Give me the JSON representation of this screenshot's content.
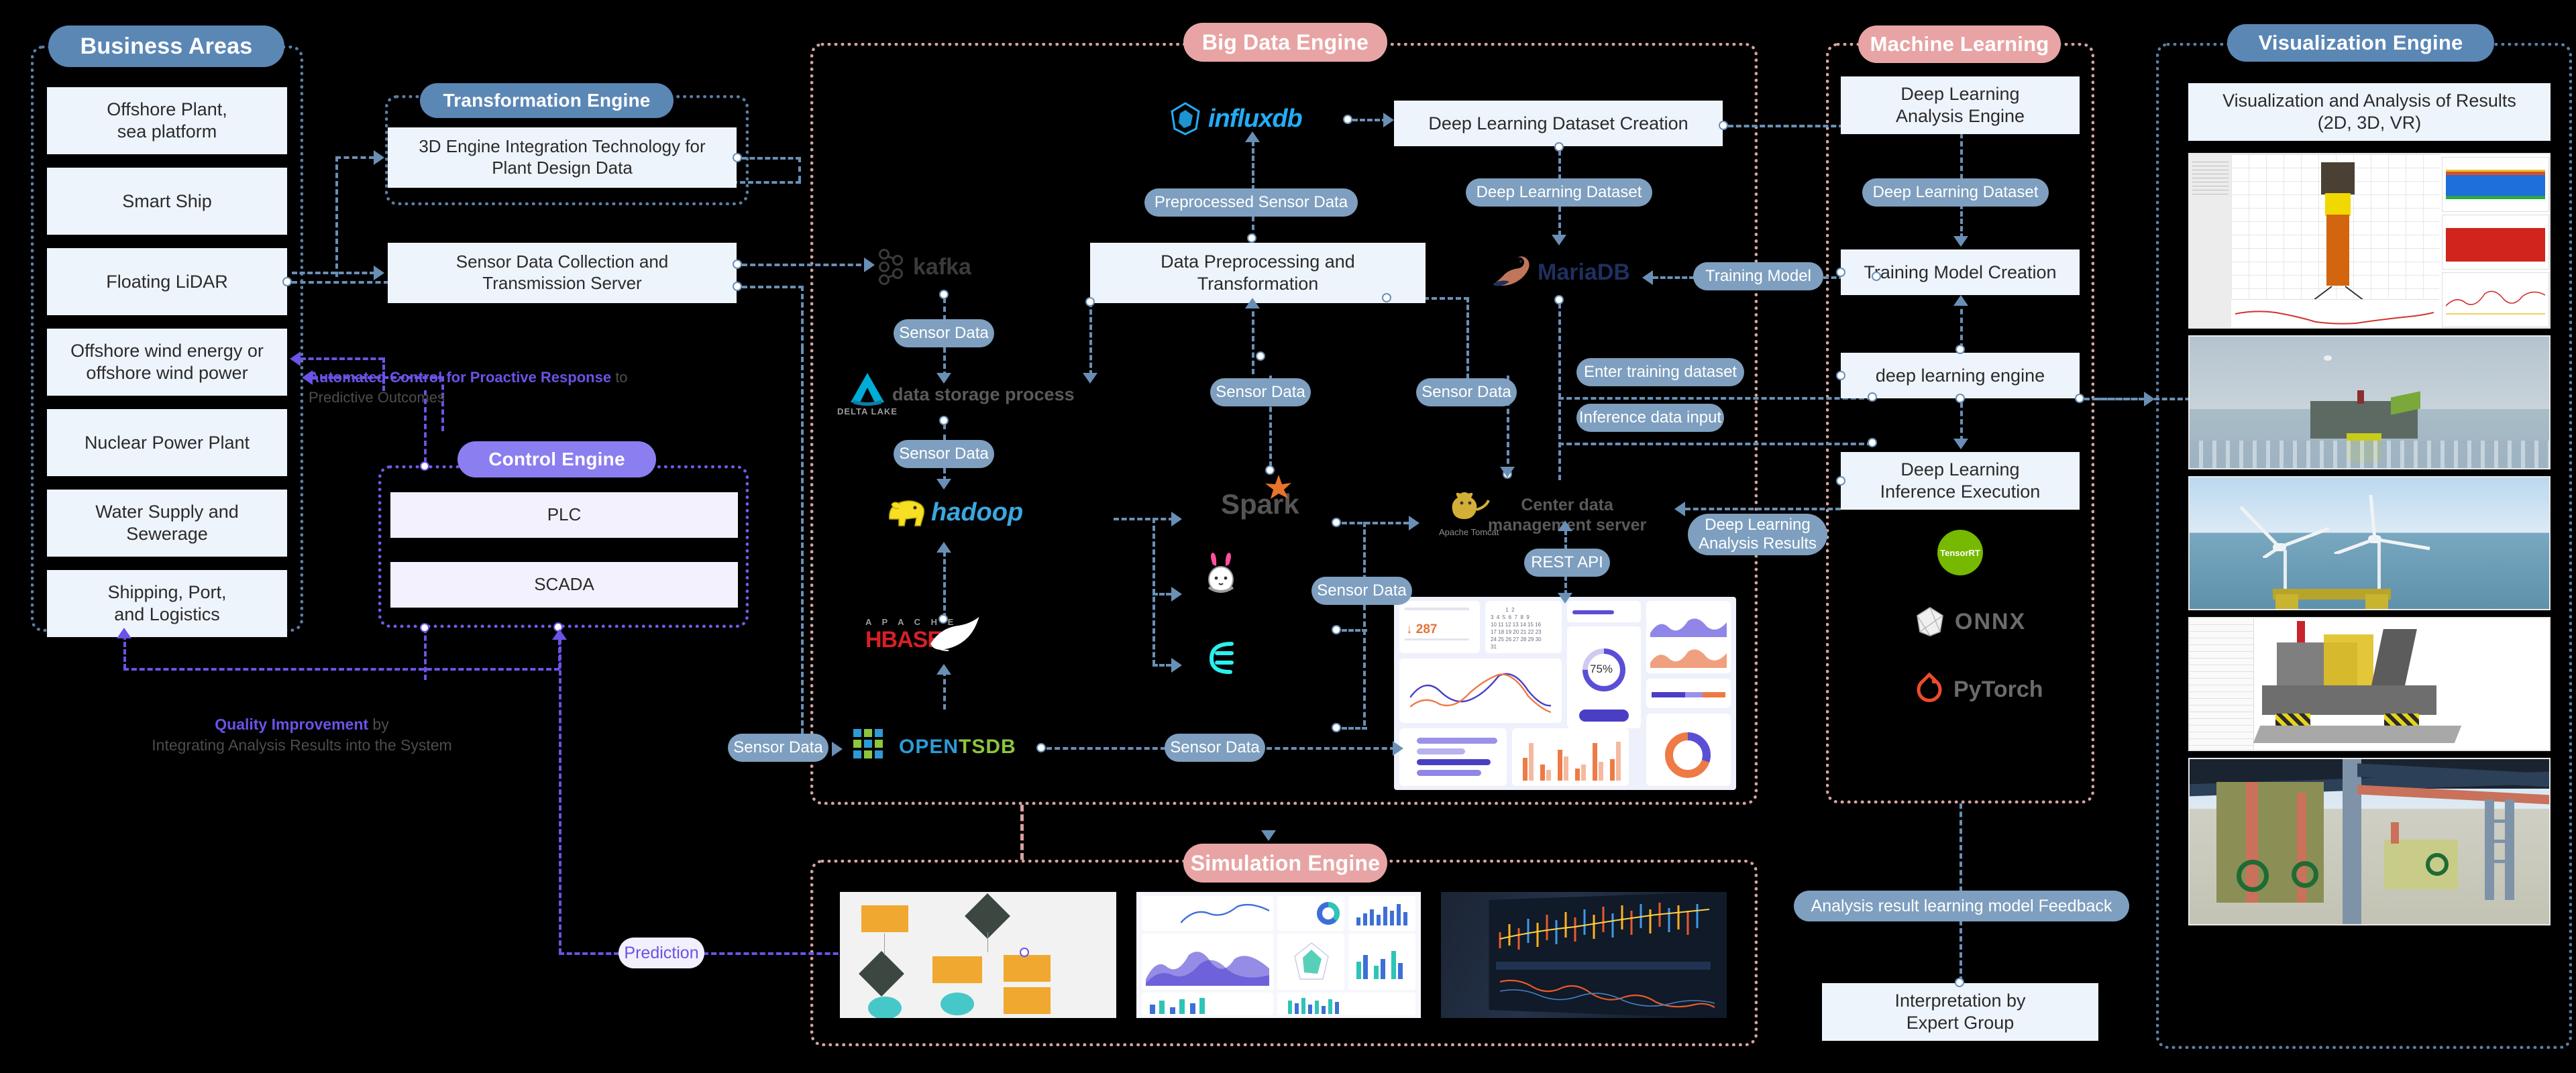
{
  "groups": {
    "business_areas": {
      "title": "Business Areas"
    },
    "transformation_engine": {
      "title": "Transformation Engine"
    },
    "control_engine": {
      "title": "Control Engine"
    },
    "big_data_engine": {
      "title": "Big Data Engine"
    },
    "machine_learning": {
      "title": "Machine Learning"
    },
    "visualization_engine": {
      "title": "Visualization Engine"
    },
    "simulation_engine": {
      "title": "Simulation Engine"
    }
  },
  "business_areas": {
    "items": [
      {
        "label": "Offshore Plant,\nsea platform"
      },
      {
        "label": "Smart Ship"
      },
      {
        "label": "Floating LiDAR"
      },
      {
        "label": "Offshore wind energy or\noffshore wind power"
      },
      {
        "label": "Nuclear Power Plant"
      },
      {
        "label": "Water Supply and\nSewerage"
      },
      {
        "label": "Shipping, Port,\nand Logistics"
      }
    ]
  },
  "transformation_engine": {
    "items": [
      {
        "label": "3D Engine Integration Technology for\nPlant Design Data"
      },
      {
        "label": "Sensor Data Collection and\nTransmission Server"
      }
    ]
  },
  "control_engine": {
    "items": [
      {
        "label": "PLC"
      },
      {
        "label": "SCADA"
      }
    ]
  },
  "big_data_engine": {
    "boxes": [
      {
        "label": "Deep Learning Dataset Creation"
      },
      {
        "label": "Data Preprocessing and\nTransformation"
      }
    ],
    "logos": [
      {
        "name": "influxdb",
        "label": "influxdb"
      },
      {
        "name": "kafka",
        "label": "kafka"
      },
      {
        "name": "delta-lake",
        "label": "DELTA LAKE"
      },
      {
        "name": "hadoop",
        "label": "hadoop"
      },
      {
        "name": "apache-hbase",
        "label_top": "A P A C H E",
        "label": "HBASE"
      },
      {
        "name": "opentsdb",
        "label_a": "OPEN",
        "label_b": "TSDB"
      },
      {
        "name": "spark",
        "label": "Spark"
      },
      {
        "name": "mariadb",
        "label": "MariaDB"
      },
      {
        "name": "apache-tomcat",
        "label": "Apache Tomcat"
      },
      {
        "name": "rabbitmq",
        "label": ""
      },
      {
        "name": "apache-druid",
        "label": ""
      }
    ],
    "texts": [
      {
        "label": "data storage process"
      },
      {
        "label": "Center data\nmanagement server"
      }
    ]
  },
  "machine_learning": {
    "boxes": [
      {
        "label": "Deep Learning\nAnalysis Engine"
      },
      {
        "label": "Training Model Creation"
      },
      {
        "label": "deep learning engine"
      },
      {
        "label": "Deep Learning\nInference Execution"
      },
      {
        "label": "Interpretation by\nExpert Group"
      }
    ],
    "logos": [
      {
        "name": "tensorrt",
        "label": "TensorRT"
      },
      {
        "name": "onnx",
        "label": "ONNX"
      },
      {
        "name": "pytorch",
        "label": "PyTorch"
      }
    ]
  },
  "visualization_engine": {
    "header": "Visualization and Analysis of Results\n(2D, 3D, VR)"
  },
  "flow_labels": {
    "preprocessed_sensor_data": "Preprocessed Sensor Data",
    "deep_learning_dataset": "Deep Learning Dataset",
    "deep_learning_dataset_ml": "Deep Learning Dataset",
    "training_model": "Training Model",
    "enter_training_dataset": "Enter training dataset",
    "inference_data_input": "Inference data input",
    "rest_api": "REST API",
    "deep_learning_analysis_results": "Deep Learning\nAnalysis Results",
    "analysis_result_feedback": "Analysis result learning model Feedback",
    "prediction": "Prediction",
    "sensor_data_kafka": "Sensor Data",
    "sensor_data_delta": "Sensor Data",
    "sensor_data_center": "Sensor Data",
    "sensor_data_mid": "Sensor Data",
    "sensor_data_right": "Sensor Data",
    "sensor_data_spark": "Sensor Data",
    "sensor_data_opentsdb": "Sensor Data",
    "sensor_data_dashboard": "Sensor Data"
  },
  "annotations": {
    "automated_control": {
      "highlight": "Automated Control for Proactive Response",
      "rest": " to\nPredictive Outcomes"
    },
    "quality_improvement": {
      "highlight": "Quality Improvement",
      "rest": " by\nIntegrating Analysis Results into the System"
    }
  },
  "colors": {
    "background": "#000000",
    "blue_accent": "#5b87b5",
    "purple_accent": "#8b7ef0",
    "red_accent": "#e8a4a4",
    "box_fill": "#eef4fc",
    "chip_fill": "#7e9fbf"
  }
}
